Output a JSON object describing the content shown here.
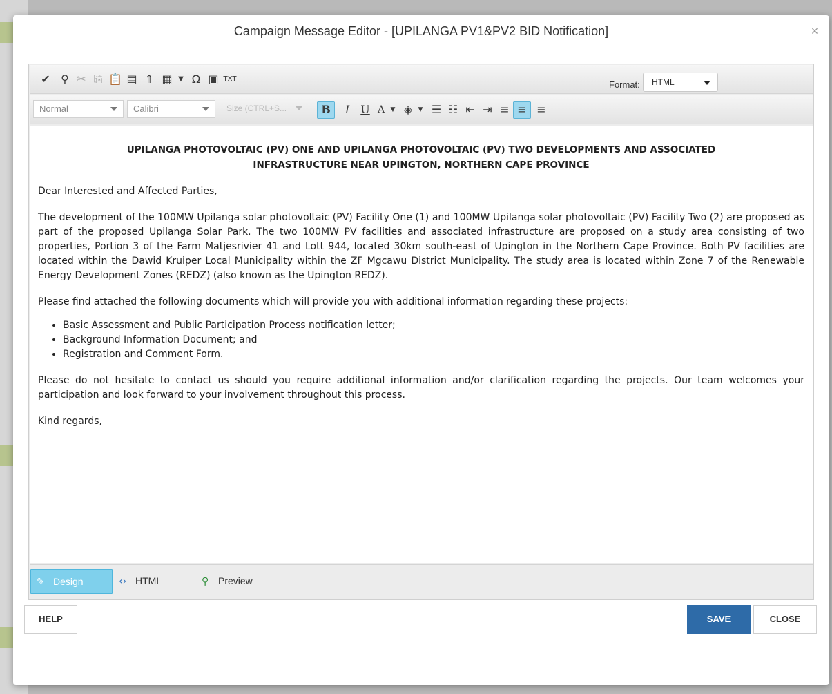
{
  "window": {
    "title": "Campaign Message Editor - [UPILANGA PV1&PV2 BID Notification]",
    "close_glyph": "×"
  },
  "toolbar": {
    "row1_icons": [
      "spellcheck-icon",
      "find-icon",
      "cut-icon",
      "copy-icon",
      "paste-icon",
      "template-icon",
      "insert-link-icon",
      "table-icon",
      "table-dropdown-icon",
      "special-chars-icon",
      "image-icon",
      "insert-text-icon"
    ],
    "format_label": "Format:",
    "format_value": "HTML",
    "paragraph_style": "Normal",
    "font_family": "Calibri",
    "font_size": "Size (CTRL+S..."
  },
  "document": {
    "heading_line1": "UPILANGA PHOTOVOLTAIC (PV) ONE AND UPILANGA PHOTOVOLTAIC (PV) TWO DEVELOPMENTS AND ASSOCIATED",
    "heading_line2": "INFRASTRUCTURE NEAR UPINGTON, NORTHERN CAPE PROVINCE",
    "salutation": "Dear Interested and Affected Parties,",
    "paragraph1": "The development of the 100MW Upilanga solar photovoltaic (PV) Facility One (1) and 100MW Upilanga solar photovoltaic (PV) Facility Two (2) are proposed as part of the proposed Upilanga Solar Park.  The two 100MW PV facilities and associated infrastructure are proposed on a study area consisting of two properties, Portion 3 of the Farm Matjesrivier 41 and Lott 944, located 30km south-east of Upington in the Northern Cape Province.  Both PV facilities are located within the Dawid Kruiper Local Municipality within the ZF Mgcawu District Municipality.  The study area is located within Zone 7 of the Renewable Energy Development Zones (REDZ) (also known as the Upington REDZ).",
    "paragraph2": "Please find attached the following documents which will provide you with additional information regarding these projects:",
    "bullets": [
      "Basic Assessment and Public Participation Process notification letter;",
      "Background Information Document; and",
      "Registration and Comment Form."
    ],
    "paragraph3": "Please do not hesitate to contact us should you require additional information and/or clarification regarding the projects.  Our team welcomes your participation and look forward to your involvement throughout this process.",
    "closing": "Kind regards,"
  },
  "modes": {
    "design": "Design",
    "html": "HTML",
    "preview": "Preview"
  },
  "buttons": {
    "help": "HELP",
    "save": "SAVE",
    "close": "CLOSE"
  },
  "colors": {
    "primary": "#2e6ba8",
    "active_tab": "#7fd0ec",
    "spell_underline": "#d31d1d"
  }
}
